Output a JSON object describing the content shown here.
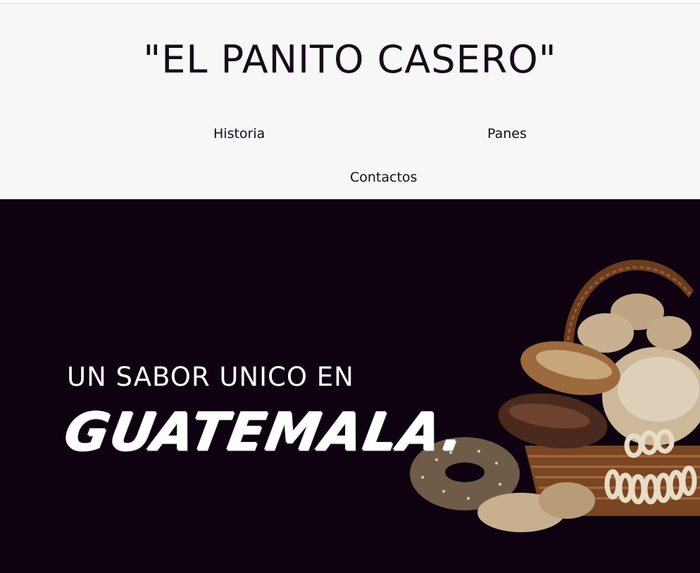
{
  "header": {
    "title": "\"EL PANITO CASERO\"",
    "nav": {
      "historia": "Historia",
      "panes": "Panes",
      "contactos": "Contactos"
    }
  },
  "hero": {
    "line1": "UN SABOR UNICO EN",
    "line2": "GUATEMALA.",
    "image_label": "bread-basket-image"
  },
  "colors": {
    "header_bg": "#f7f7f8",
    "hero_bg": "#0e0211",
    "text_dark": "#160b19",
    "text_light": "#ffffff"
  }
}
